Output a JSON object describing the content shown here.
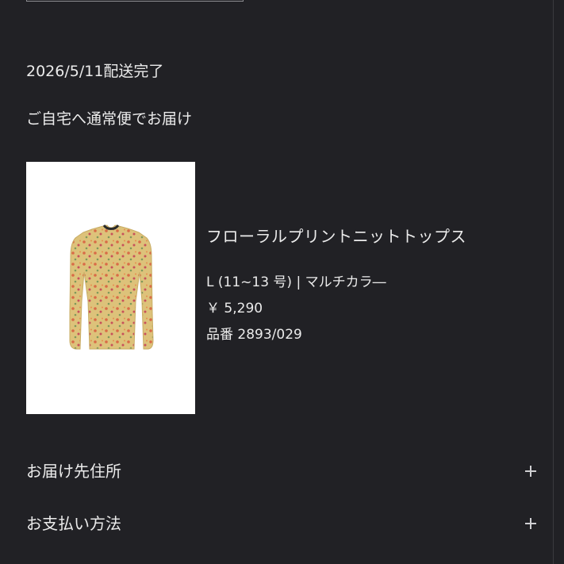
{
  "order": {
    "delivery_date": "2026/5/11配送完了",
    "delivery_method": "ご自宅へ通常便でお届け"
  },
  "product": {
    "name": "フローラルプリントニットトップス",
    "variant": "L (11~13 号) | マルチカラ―",
    "price": "￥ 5,290",
    "code": "品番 2893/029",
    "image_icon": "floral-knit-top-photo"
  },
  "sections": [
    {
      "label": "お届け先住所",
      "icon": "plus-icon"
    },
    {
      "label": "お支払い方法",
      "icon": "plus-icon"
    }
  ],
  "colors": {
    "background": "#212125",
    "text": "#ebebeb",
    "image_background": "#ffffff"
  }
}
